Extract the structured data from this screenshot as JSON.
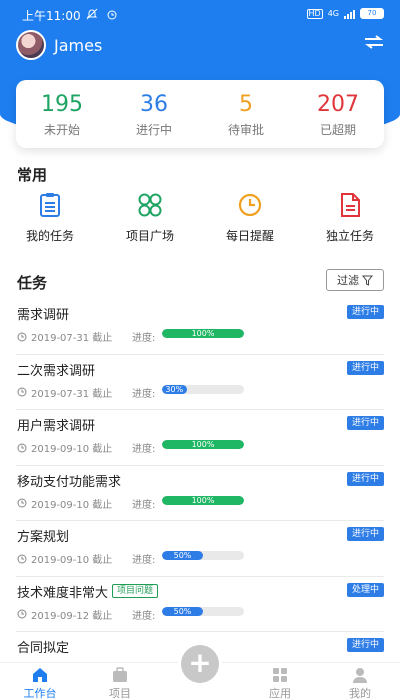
{
  "status_bar": {
    "time": "上午11:00",
    "icons": [
      "mute-icon",
      "alarm-icon"
    ],
    "hd": "HD",
    "net": "4G",
    "battery": "70"
  },
  "profile": {
    "name": "James",
    "switch_icon": "switch-icon"
  },
  "stats": [
    {
      "value": "195",
      "label": "未开始",
      "color": "#1fa463"
    },
    {
      "value": "36",
      "label": "进行中",
      "color": "#2e7de6"
    },
    {
      "value": "5",
      "label": "待审批",
      "color": "#f0a020"
    },
    {
      "value": "207",
      "label": "已超期",
      "color": "#e0363b"
    }
  ],
  "common": {
    "title": "常用",
    "items": [
      {
        "label": "我的任务",
        "icon": "task-list-icon",
        "color": "#2e7de6"
      },
      {
        "label": "项目广场",
        "icon": "project-square-icon",
        "color": "#1fa463"
      },
      {
        "label": "每日提醒",
        "icon": "clock-icon",
        "color": "#f0a020"
      },
      {
        "label": "独立任务",
        "icon": "document-icon",
        "color": "#e0363b"
      }
    ]
  },
  "tasks_section": {
    "title": "任务",
    "filter_label": "过滤"
  },
  "tasks": [
    {
      "title": "需求调研",
      "tag": "",
      "status": "进行中",
      "date": "2019-07-31 截止",
      "progress_label": "进度:",
      "progress": 100,
      "progress_text": "100%",
      "bar_color": "#1fb764"
    },
    {
      "title": "二次需求调研",
      "tag": "",
      "status": "进行中",
      "date": "2019-07-31 截止",
      "progress_label": "进度:",
      "progress": 30,
      "progress_text": "30%",
      "bar_color": "#2e7de6"
    },
    {
      "title": "用户需求调研",
      "tag": "",
      "status": "进行中",
      "date": "2019-09-10 截止",
      "progress_label": "进度:",
      "progress": 100,
      "progress_text": "100%",
      "bar_color": "#1fb764"
    },
    {
      "title": "移动支付功能需求",
      "tag": "",
      "status": "进行中",
      "date": "2019-09-10 截止",
      "progress_label": "进度:",
      "progress": 100,
      "progress_text": "100%",
      "bar_color": "#1fb764"
    },
    {
      "title": "方案规划",
      "tag": "",
      "status": "进行中",
      "date": "2019-09-10 截止",
      "progress_label": "进度:",
      "progress": 50,
      "progress_text": "50%",
      "bar_color": "#2e7de6"
    },
    {
      "title": "技术难度非常大",
      "tag": "项目问题",
      "status": "处理中",
      "date": "2019-09-12 截止",
      "progress_label": "进度:",
      "progress": 50,
      "progress_text": "50%",
      "bar_color": "#2e7de6"
    },
    {
      "title": "合同拟定",
      "tag": "",
      "status": "进行中",
      "date": "",
      "progress_label": "",
      "progress": null,
      "progress_text": "",
      "bar_color": "#2e7de6"
    }
  ],
  "bottom_nav": [
    {
      "label": "工作台",
      "icon": "home-icon",
      "active": true
    },
    {
      "label": "项目",
      "icon": "briefcase-icon",
      "active": false
    },
    {
      "label": "应用",
      "icon": "grid-icon",
      "active": false
    },
    {
      "label": "我的",
      "icon": "user-icon",
      "active": false
    }
  ],
  "fab": {
    "label": "+",
    "icon": "plus-icon"
  }
}
